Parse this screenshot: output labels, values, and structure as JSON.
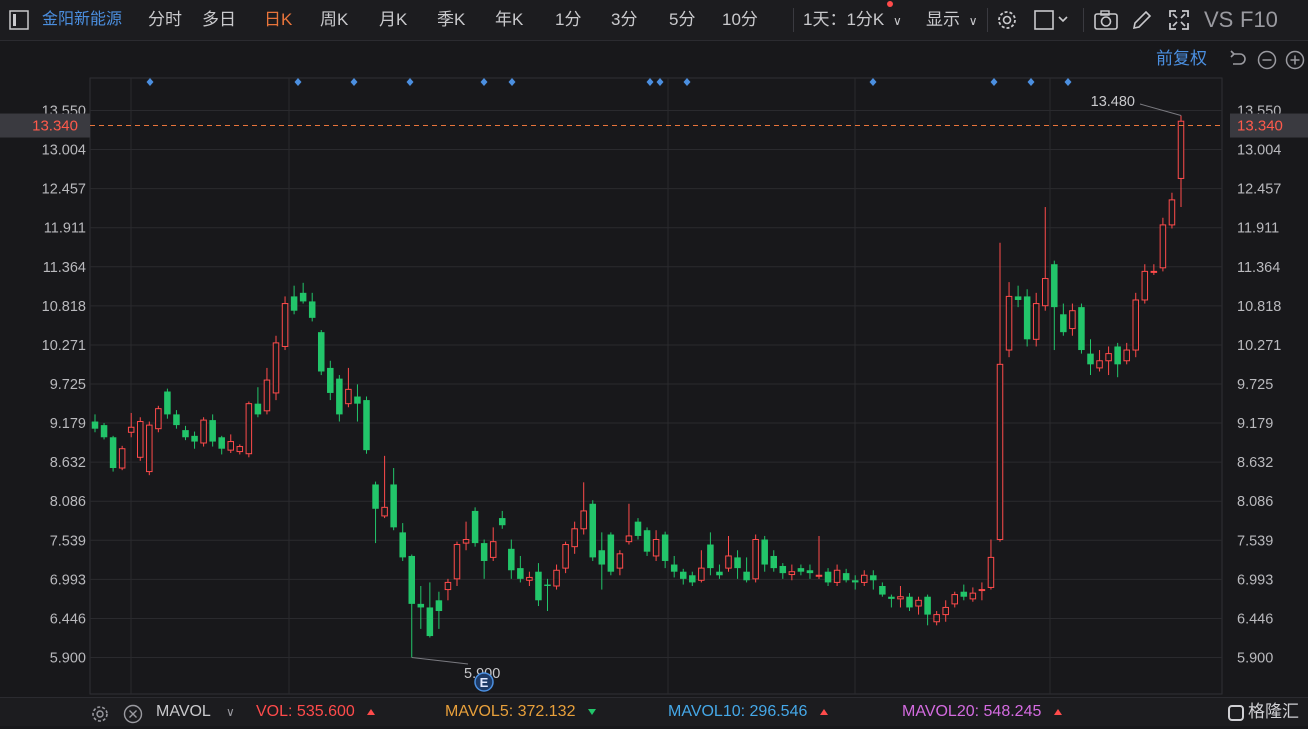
{
  "toolbar": {
    "stock_name": "金阳新能源",
    "periods": [
      "分时",
      "多日",
      "日K",
      "周K",
      "月K",
      "季K",
      "年K",
      "1分",
      "3分",
      "5分",
      "10分"
    ],
    "active_period": "日K",
    "interval_select": "1天：1分K",
    "display_label": "显示",
    "vs_label": "VS",
    "f10_label": "F10"
  },
  "adjust_label": "前复权",
  "price_axis": {
    "ticks": [
      "13.550",
      "13.004",
      "12.457",
      "11.911",
      "11.364",
      "10.818",
      "10.271",
      "9.725",
      "9.179",
      "8.632",
      "8.086",
      "7.539",
      "6.993",
      "6.446",
      "5.900"
    ],
    "current_price": "13.340",
    "high_label": "13.480",
    "low_label": "5.900",
    "event_marker": "E"
  },
  "colors": {
    "up": "#ff4b4b",
    "down": "#22c56a",
    "accent": "#e8743b",
    "link": "#4b8fe0",
    "background": "#18181b",
    "grid": "#2a2a2e"
  },
  "bottom": {
    "indicator": "MAVOL",
    "vol_label": "VOL:",
    "vol_value": "535.600",
    "mavol5_label": "MAVOL5:",
    "mavol5_value": "372.132",
    "mavol10_label": "MAVOL10:",
    "mavol10_value": "296.546",
    "mavol20_label": "MAVOL20:",
    "mavol20_value": "548.245",
    "brand": "格隆汇"
  },
  "icons": [
    "layout-icon",
    "gear-icon",
    "checkbox-icon",
    "camera-icon",
    "pencil-icon",
    "fullscreen-icon",
    "undo-icon",
    "zoom-out-icon",
    "zoom-in-icon",
    "close-icon",
    "chevron-down-icon"
  ],
  "chart_data": {
    "type": "candlestick",
    "title": "",
    "ylim": [
      5.9,
      13.55
    ],
    "markers_count": 13,
    "candles": [
      [
        9.2,
        9.1,
        9.3,
        9.05
      ],
      [
        9.15,
        8.98,
        9.18,
        8.95
      ],
      [
        8.98,
        8.55,
        9.0,
        8.5
      ],
      [
        8.55,
        8.82,
        8.86,
        8.52
      ],
      [
        9.05,
        9.12,
        9.32,
        8.98
      ],
      [
        8.7,
        9.2,
        9.26,
        8.65
      ],
      [
        8.5,
        9.15,
        9.2,
        8.45
      ],
      [
        9.1,
        9.38,
        9.42,
        9.05
      ],
      [
        9.62,
        9.3,
        9.66,
        9.24
      ],
      [
        9.3,
        9.15,
        9.36,
        9.1
      ],
      [
        9.08,
        8.98,
        9.14,
        8.94
      ],
      [
        9.0,
        8.92,
        9.06,
        8.82
      ],
      [
        8.9,
        9.22,
        9.26,
        8.85
      ],
      [
        9.22,
        8.92,
        9.3,
        8.85
      ],
      [
        8.98,
        8.82,
        9.0,
        8.74
      ],
      [
        8.8,
        8.92,
        9.02,
        8.76
      ],
      [
        8.78,
        8.85,
        8.88,
        8.74
      ],
      [
        8.75,
        9.45,
        9.48,
        8.7
      ],
      [
        9.45,
        9.3,
        9.68,
        9.26
      ],
      [
        9.35,
        9.78,
        9.95,
        9.3
      ],
      [
        9.6,
        10.3,
        10.4,
        9.5
      ],
      [
        10.25,
        10.85,
        10.95,
        10.2
      ],
      [
        10.95,
        10.75,
        11.1,
        10.7
      ],
      [
        11.0,
        10.88,
        11.14,
        10.85
      ],
      [
        10.88,
        10.65,
        11.0,
        10.6
      ],
      [
        10.45,
        9.9,
        10.48,
        9.85
      ],
      [
        9.95,
        9.6,
        10.05,
        9.5
      ],
      [
        9.8,
        9.3,
        9.85,
        9.2
      ],
      [
        9.45,
        9.65,
        9.95,
        9.4
      ],
      [
        9.55,
        9.45,
        9.72,
        9.2
      ],
      [
        9.5,
        8.8,
        9.55,
        8.75
      ],
      [
        8.32,
        7.98,
        8.36,
        7.5
      ],
      [
        7.88,
        8.0,
        8.72,
        7.85
      ],
      [
        8.32,
        7.72,
        8.55,
        7.68
      ],
      [
        7.65,
        7.3,
        7.78,
        7.25
      ],
      [
        7.32,
        6.65,
        7.34,
        5.9
      ],
      [
        6.65,
        6.6,
        6.9,
        6.3
      ],
      [
        6.6,
        6.2,
        6.95,
        6.18
      ],
      [
        6.7,
        6.55,
        6.82,
        6.3
      ],
      [
        6.85,
        6.95,
        7.0,
        6.7
      ],
      [
        7.0,
        7.48,
        7.52,
        6.9
      ],
      [
        7.5,
        7.55,
        7.8,
        7.4
      ],
      [
        7.95,
        7.5,
        8.0,
        7.45
      ],
      [
        7.5,
        7.25,
        7.55,
        7.0
      ],
      [
        7.3,
        7.52,
        7.72,
        7.25
      ],
      [
        7.85,
        7.75,
        7.95,
        7.7
      ],
      [
        7.42,
        7.12,
        7.55,
        7.0
      ],
      [
        7.15,
        7.0,
        7.32,
        6.95
      ],
      [
        6.98,
        7.02,
        7.1,
        6.9
      ],
      [
        7.1,
        6.7,
        7.22,
        6.62
      ],
      [
        6.92,
        6.9,
        7.0,
        6.55
      ],
      [
        6.9,
        7.12,
        7.2,
        6.85
      ],
      [
        7.15,
        7.48,
        7.52,
        7.08
      ],
      [
        7.45,
        7.7,
        7.8,
        7.35
      ],
      [
        7.7,
        7.95,
        8.35,
        7.62
      ],
      [
        8.05,
        7.3,
        8.1,
        7.25
      ],
      [
        7.4,
        7.2,
        7.65,
        6.85
      ],
      [
        7.62,
        7.1,
        7.65,
        7.05
      ],
      [
        7.15,
        7.35,
        7.4,
        7.05
      ],
      [
        7.52,
        7.6,
        8.05,
        7.48
      ],
      [
        7.8,
        7.6,
        7.85,
        7.55
      ],
      [
        7.68,
        7.38,
        7.72,
        7.32
      ],
      [
        7.32,
        7.55,
        7.68,
        7.25
      ],
      [
        7.62,
        7.25,
        7.66,
        7.15
      ],
      [
        7.2,
        7.1,
        7.32,
        7.02
      ],
      [
        7.1,
        7.0,
        7.14,
        6.92
      ],
      [
        7.05,
        6.95,
        7.1,
        6.9
      ],
      [
        6.98,
        7.15,
        7.4,
        6.95
      ],
      [
        7.48,
        7.15,
        7.65,
        7.05
      ],
      [
        7.1,
        7.05,
        7.2,
        7.0
      ],
      [
        7.15,
        7.32,
        7.6,
        7.1
      ],
      [
        7.3,
        7.15,
        7.4,
        7.0
      ],
      [
        7.1,
        6.98,
        7.3,
        6.95
      ],
      [
        7.0,
        7.55,
        7.62,
        6.95
      ],
      [
        7.55,
        7.2,
        7.6,
        7.1
      ],
      [
        7.32,
        7.15,
        7.4,
        7.1
      ],
      [
        7.18,
        7.08,
        7.22,
        7.0
      ],
      [
        7.06,
        7.1,
        7.2,
        6.98
      ],
      [
        7.15,
        7.1,
        7.2,
        7.05
      ],
      [
        7.12,
        7.08,
        7.2,
        7.0
      ],
      [
        7.05,
        7.05,
        7.6,
        7.0
      ],
      [
        7.1,
        6.95,
        7.15,
        6.9
      ],
      [
        6.95,
        7.12,
        7.2,
        6.9
      ],
      [
        7.08,
        6.98,
        7.14,
        6.95
      ],
      [
        6.98,
        6.95,
        7.05,
        6.85
      ],
      [
        6.95,
        7.05,
        7.12,
        6.9
      ],
      [
        7.05,
        6.98,
        7.12,
        6.85
      ],
      [
        6.9,
        6.78,
        6.95,
        6.75
      ],
      [
        6.75,
        6.72,
        6.78,
        6.6
      ],
      [
        6.72,
        6.75,
        6.9,
        6.6
      ],
      [
        6.75,
        6.6,
        6.8,
        6.55
      ],
      [
        6.62,
        6.7,
        6.75,
        6.5
      ],
      [
        6.75,
        6.5,
        6.78,
        6.35
      ],
      [
        6.4,
        6.5,
        6.55,
        6.35
      ],
      [
        6.5,
        6.6,
        6.7,
        6.4
      ],
      [
        6.65,
        6.78,
        6.82,
        6.6
      ],
      [
        6.82,
        6.75,
        6.92,
        6.7
      ],
      [
        6.72,
        6.8,
        6.88,
        6.68
      ],
      [
        6.85,
        6.85,
        6.95,
        6.7
      ],
      [
        6.88,
        7.3,
        7.55,
        6.85
      ],
      [
        7.55,
        10.0,
        11.7,
        7.52
      ],
      [
        10.2,
        10.95,
        11.15,
        10.1
      ],
      [
        10.95,
        10.9,
        11.1,
        10.8
      ],
      [
        10.95,
        10.35,
        11.05,
        10.25
      ],
      [
        10.35,
        10.85,
        11.0,
        10.25
      ],
      [
        10.82,
        11.2,
        12.2,
        10.75
      ],
      [
        11.4,
        10.8,
        11.45,
        10.2
      ],
      [
        10.7,
        10.45,
        10.85,
        10.4
      ],
      [
        10.5,
        10.75,
        10.85,
        10.4
      ],
      [
        10.8,
        10.2,
        10.85,
        10.15
      ],
      [
        10.15,
        10.0,
        10.35,
        9.85
      ],
      [
        9.95,
        10.05,
        10.2,
        9.9
      ],
      [
        10.05,
        10.15,
        10.25,
        9.85
      ],
      [
        10.25,
        10.0,
        10.3,
        9.82
      ],
      [
        10.05,
        10.2,
        10.3,
        10.0
      ],
      [
        10.2,
        10.9,
        11.0,
        10.1
      ],
      [
        10.9,
        11.3,
        11.4,
        10.85
      ],
      [
        11.3,
        11.3,
        11.4,
        11.25
      ],
      [
        11.35,
        11.95,
        12.05,
        11.3
      ],
      [
        11.95,
        12.3,
        12.4,
        11.9
      ],
      [
        12.6,
        13.4,
        13.48,
        12.2
      ]
    ]
  }
}
